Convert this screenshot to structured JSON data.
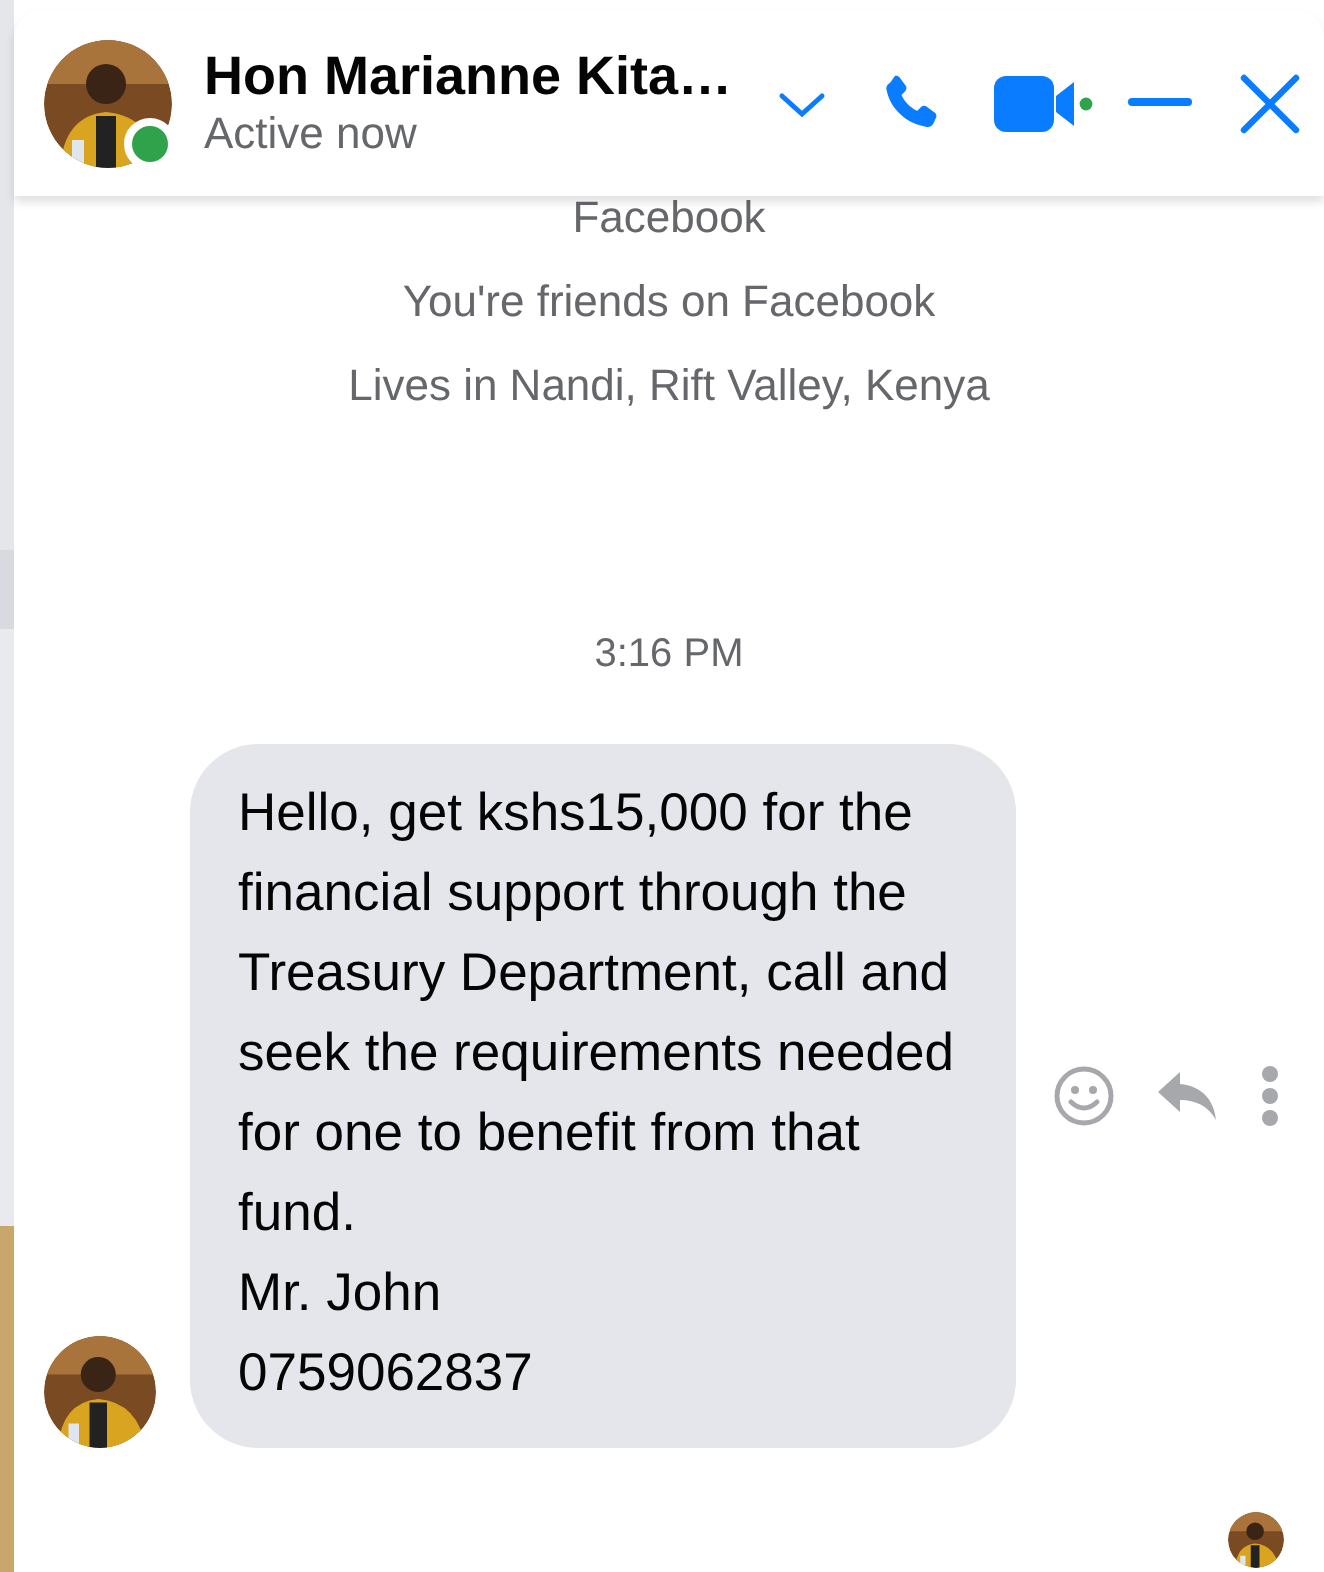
{
  "contact": {
    "name": "Hon Marianne Kita…",
    "status": "Active now",
    "online": true
  },
  "intro": [
    "Facebook",
    "You're friends on Facebook",
    "Lives in Nandi, Rift Valley, Kenya"
  ],
  "timestamp": "3:16 PM",
  "message": {
    "lines": [
      "Hello, get kshs15,000 for the financial support through the Treasury Department, call and seek the requirements needed for one to benefit from that fund.",
      "Mr. John",
      "0759062837"
    ]
  },
  "seen": true
}
